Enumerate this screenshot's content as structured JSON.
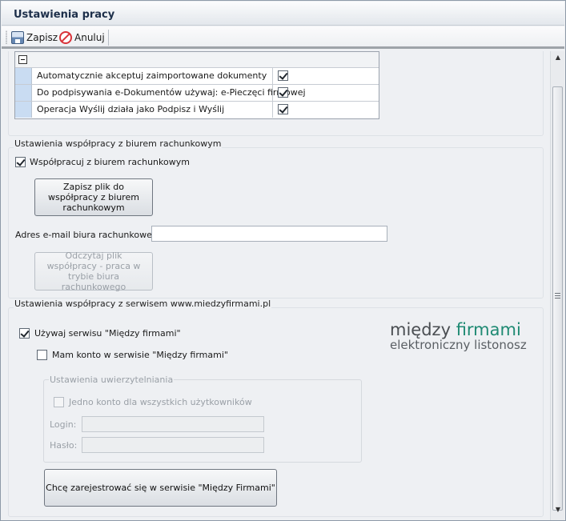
{
  "window": {
    "title": "Ustawienia pracy"
  },
  "toolbar": {
    "save_label": "Zapisz",
    "cancel_label": "Anuluj"
  },
  "grid": {
    "rows": [
      {
        "label": "Automatycznie akceptuj zaimportowane dokumenty",
        "checked": true
      },
      {
        "label": "Do podpisywania e-Dokumentów używaj: e-Pieczęci firmowej",
        "checked": true
      },
      {
        "label": "Operacja Wyślij działa jako Podpisz i Wyślij",
        "checked": true
      }
    ]
  },
  "accounting": {
    "legend": "Ustawienia współpracy z biurem rachunkowym",
    "cooperate_label": "Współpracuj z biurem rachunkowym",
    "cooperate_checked": true,
    "save_file_button": "Zapisz plik do współpracy z biurem rachunkowym",
    "email_label": "Adres e-mail biura rachunkowego:",
    "email_value": "",
    "read_file_button": "Odczytaj plik współpracy - praca w trybie biura rachunkowego"
  },
  "service": {
    "legend": "Ustawienia współpracy z serwisem www.miedzyfirmami.pl",
    "use_service_label": "Używaj serwisu \"Między firmami\"",
    "use_service_checked": true,
    "has_account_label": "Mam konto w serwisie \"Między firmami\"",
    "has_account_checked": false,
    "auth_legend": "Ustawienia uwierzytelniania",
    "one_account_label": "Jedno konto dla wszystkich użytkowników",
    "login_label": "Login:",
    "login_value": "",
    "password_label": "Hasło:",
    "password_value": "",
    "register_button": "Chcę zarejestrować się w serwisie \"Między Firmami\"",
    "logo_word1": "między",
    "logo_word2": "firmami",
    "logo_tagline": "elektroniczny listonosz"
  }
}
